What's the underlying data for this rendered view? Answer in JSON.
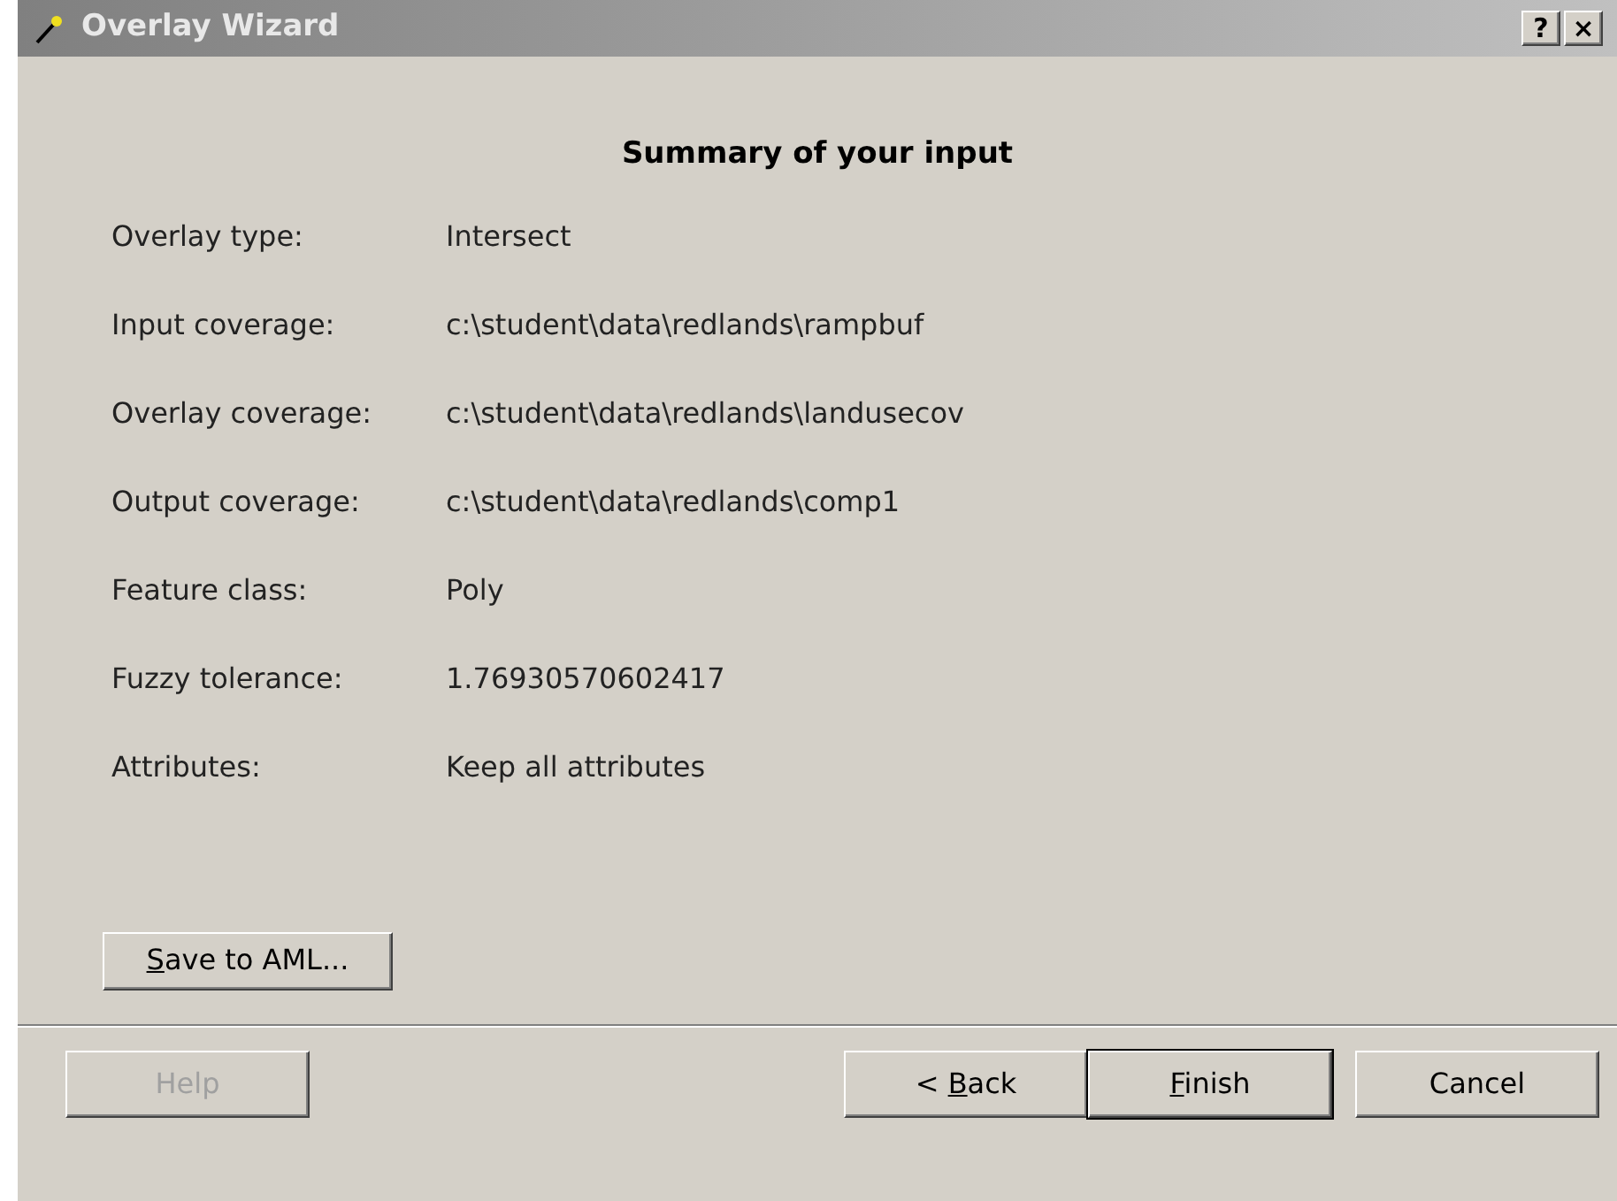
{
  "window": {
    "title": "Overlay Wizard",
    "title_buttons": [
      "?",
      "×"
    ]
  },
  "heading": "Summary of your input",
  "fields": [
    {
      "label": "Overlay type:",
      "value": "Intersect"
    },
    {
      "label": "Input coverage:",
      "value": "c:\\student\\data\\redlands\\rampbuf"
    },
    {
      "label": "Overlay coverage:",
      "value": "c:\\student\\data\\redlands\\landusecov"
    },
    {
      "label": "Output coverage:",
      "value": "c:\\student\\data\\redlands\\comp1"
    },
    {
      "label": "Feature class:",
      "value": "Poly"
    },
    {
      "label": "Fuzzy tolerance:",
      "value": "1.76930570602417"
    },
    {
      "label": "Attributes:",
      "value": "Keep all attributes"
    }
  ],
  "save_button": {
    "key": "S",
    "after": "ave to AML..."
  },
  "buttons": [
    {
      "before": "Help",
      "disabled": true,
      "default": false
    },
    {
      "before": "< ",
      "key": "B",
      "after": "ack",
      "disabled": false,
      "default": false
    },
    {
      "key": "F",
      "after": "inish",
      "disabled": false,
      "default": true
    },
    {
      "before": "Cancel",
      "disabled": false,
      "default": false
    }
  ]
}
